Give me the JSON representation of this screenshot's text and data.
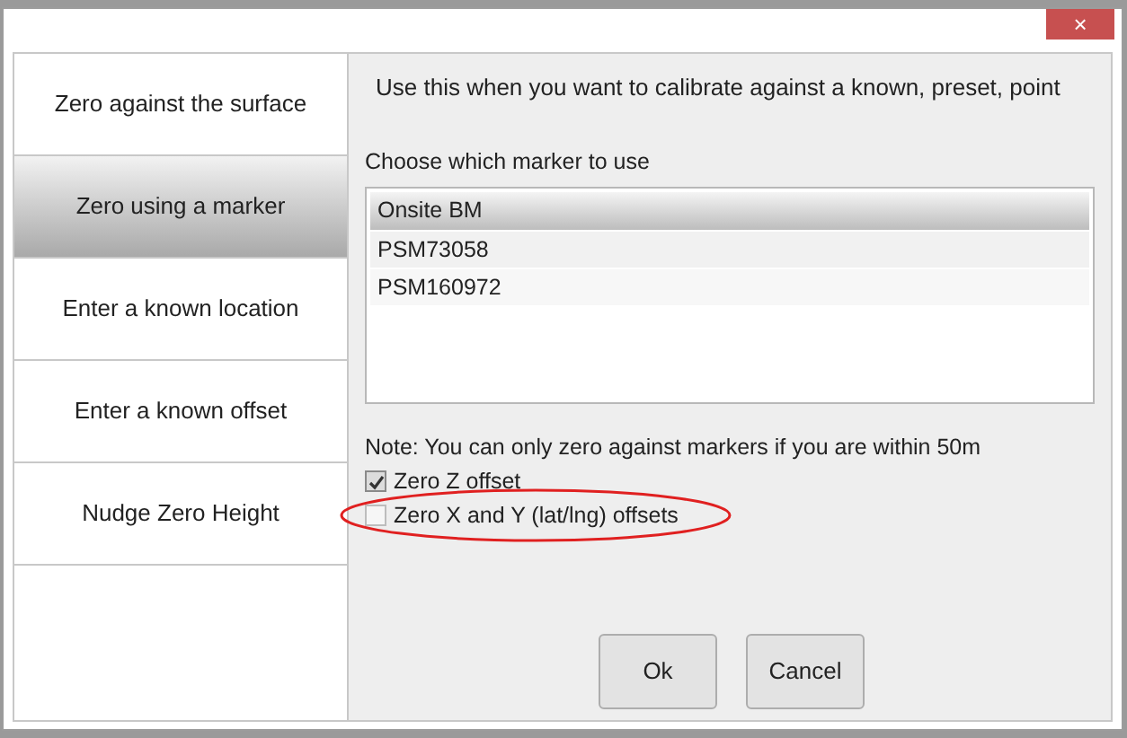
{
  "window": {
    "close_label": "×"
  },
  "sidebar": {
    "items": [
      {
        "label": "Zero against the surface",
        "selected": false
      },
      {
        "label": "Zero using a marker",
        "selected": true
      },
      {
        "label": "Enter a known location",
        "selected": false
      },
      {
        "label": "Enter a known offset",
        "selected": false
      },
      {
        "label": "Nudge Zero Height",
        "selected": false
      }
    ]
  },
  "panel": {
    "description": "Use this when you want to calibrate against a known, preset, point",
    "list_label": "Choose which marker to use",
    "markers": [
      {
        "label": "Onsite BM",
        "selected": true
      },
      {
        "label": "PSM73058",
        "selected": false
      },
      {
        "label": "PSM160972",
        "selected": false
      }
    ],
    "note": "Note: You can only zero against markers if you are within 50m",
    "options": [
      {
        "label": "Zero Z offset",
        "checked": true
      },
      {
        "label": "Zero X and Y (lat/lng) offsets",
        "checked": false,
        "highlighted": true
      }
    ],
    "buttons": [
      "Ok",
      "Cancel"
    ]
  }
}
